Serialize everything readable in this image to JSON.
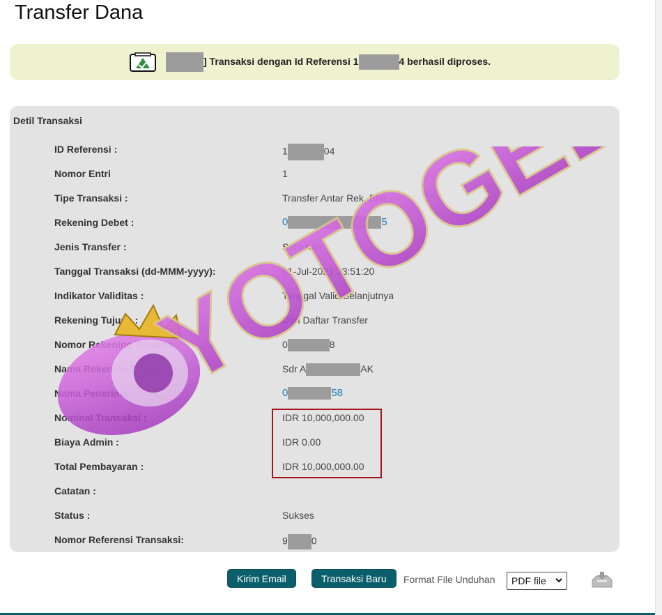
{
  "page": {
    "title": "Transfer Dana"
  },
  "banner": {
    "text_prefix": "] Transaksi dengan Id Referensi 1",
    "text_suffix": "4 berhasil diproses.",
    "status_color": "#eef2cf"
  },
  "detail": {
    "title": "Detil Transaksi",
    "rows": [
      {
        "label": "ID Referensi :",
        "value_prefix": "1",
        "value_suffix": "04"
      },
      {
        "label": "Nomor Entri",
        "value": "1"
      },
      {
        "label": "Tipe Transaksi :",
        "value": "Transfer Antar Rek. BNI"
      },
      {
        "label": "Rekening Debet :",
        "value_prefix": "0",
        "value_suffix": "5"
      },
      {
        "label": "Jenis Transfer :",
        "value": "Satu Kali"
      },
      {
        "label": "Tanggal Transaksi (dd-MMM-yyyy):",
        "value": "01-Jul-2021 23:51:20"
      },
      {
        "label": "Indikator Validitas :",
        "value": "Tanggal Valid Selanjutnya"
      },
      {
        "label": "Rekening Tujuan :",
        "value": "Dari Daftar Transfer"
      },
      {
        "label": "Nomor Rekening Tujuan :",
        "value_prefix": "0",
        "value_suffix": "8"
      },
      {
        "label": "Nama Rekening Tujuan :",
        "value_prefix": "Sdr A",
        "value_suffix": "AK"
      },
      {
        "label": "Nama Penerima :",
        "value_prefix": "0",
        "value_suffix": "58"
      },
      {
        "label": "Nominal Transaksi :",
        "value": "IDR 10,000,000.00"
      },
      {
        "label": "Biaya Admin :",
        "value": "IDR 0.00"
      },
      {
        "label": "Total Pembayaran :",
        "value": "IDR 10,000,000.00"
      },
      {
        "label": "Catatan :",
        "value": ""
      },
      {
        "label": "Status :",
        "value": "Sukses"
      },
      {
        "label": "Nomor Referensi Transaksi:",
        "value_prefix": "9",
        "value_suffix": "0"
      }
    ]
  },
  "actions": {
    "email_label": "Kirim Email",
    "new_label": "Transaksi Baru",
    "format_label": "Format File Unduhan",
    "format_value": "PDF file"
  },
  "watermark": {
    "text": "YOTOGEL"
  },
  "icons": {
    "success": "success-check-icon",
    "download": "download-tray-icon",
    "caret": "chevron-down-icon"
  },
  "colors": {
    "button": "#0b5f6a",
    "panel": "#e3e3e3",
    "link": "#1a7bb8",
    "highlight": "#a5151c",
    "watermark": "#c25bd6"
  }
}
